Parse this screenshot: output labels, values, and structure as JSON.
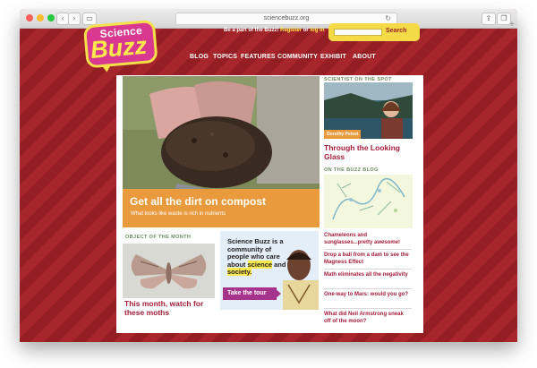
{
  "browser": {
    "url": "sciencebuzz.org",
    "back_icon": "chevron-left",
    "forward_icon": "chevron-right",
    "sidebar_icon": "sidebar",
    "reload_icon": "reload",
    "share_icon": "share",
    "tabs_icon": "tabs",
    "new_tab_icon": "plus"
  },
  "header": {
    "logo": {
      "line1": "Science",
      "line2": "Buzz"
    },
    "tagline": "Be a part of the Buzz!",
    "register": "Register",
    "or": "or",
    "login": "log in",
    "search_button": "Search",
    "search_value": ""
  },
  "nav": [
    "BLOG",
    "TOPICS",
    "FEATURES",
    "COMMUNITY",
    "EXHIBIT",
    "ABOUT"
  ],
  "hero": {
    "title": "Get all the dirt on compost",
    "subtitle": "What looks like waste is rich in nutrients"
  },
  "scientist": {
    "heading": "SCIENTIST ON THE SPOT",
    "name": "Dorothy Peteet",
    "title": "Through the Looking Glass"
  },
  "blog": {
    "heading": "ON THE BUZZ BLOG",
    "items": [
      "Chameleons and sunglasses...pretty awesome!",
      "Drop a ball from a dam to see the Magness Effect",
      "Math eliminates all the negativity",
      "One-way to Mars: would you go?",
      "What did Neil Armstrong sneak off of the moon?"
    ]
  },
  "object": {
    "heading": "OBJECT OF THE MONTH",
    "title": "This month, watch for these moths"
  },
  "promo": {
    "text_prefix": "Science Buzz is a community of people who care about",
    "science": "science",
    "and": "and",
    "society": "society.",
    "button": "Take the tour"
  },
  "colors": {
    "background_red": "#a6262c",
    "stripe_dark": "#951e24",
    "accent_orange": "#e99a3c",
    "logo_pink": "#d8388f",
    "logo_yellow": "#ffe94d",
    "link_red": "#a31d3a",
    "section_green": "#6b8a61",
    "tour_purple": "#a6348c"
  }
}
